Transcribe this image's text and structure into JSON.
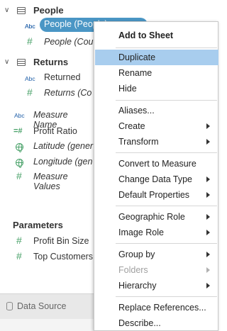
{
  "data_pane": {
    "groups": [
      {
        "name": "People",
        "fields": [
          {
            "label": "People (People)",
            "type": "Abc",
            "selected": true
          },
          {
            "label": "People (Cou",
            "type": "#",
            "italic": true
          }
        ]
      },
      {
        "name": "Returns",
        "fields": [
          {
            "label": "Returned",
            "type": "Abc"
          },
          {
            "label": "Returns (Co",
            "type": "#",
            "italic": true
          }
        ]
      }
    ],
    "loose_fields": [
      {
        "label": "Measure Name",
        "type": "Abc",
        "italic": true
      },
      {
        "label": "Profit Ratio",
        "type": "calc"
      },
      {
        "label": "Latitude (gener",
        "type": "globe",
        "italic": true
      },
      {
        "label": "Longitude (gen",
        "type": "globe",
        "italic": true
      },
      {
        "label": "Measure Values",
        "type": "#",
        "italic": true
      }
    ],
    "parameters": {
      "title": "Parameters",
      "items": [
        {
          "label": "Profit Bin Size",
          "type": "#"
        },
        {
          "label": "Top Customers",
          "type": "#"
        }
      ]
    },
    "data_source_tab": "Data Source",
    "abc_glyph": "Abc",
    "hash_glyph": "#",
    "calc_glyph": "=#"
  },
  "context_menu": {
    "items": [
      {
        "label": "Add to Sheet",
        "bold": true
      },
      {
        "label": "Duplicate",
        "highlighted": true
      },
      {
        "label": "Rename"
      },
      {
        "label": "Hide"
      },
      {
        "label": "Aliases..."
      },
      {
        "label": "Create",
        "submenu": true
      },
      {
        "label": "Transform",
        "submenu": true
      },
      {
        "label": "Convert to Measure"
      },
      {
        "label": "Change Data Type",
        "submenu": true
      },
      {
        "label": "Default Properties",
        "submenu": true
      },
      {
        "label": "Geographic Role",
        "submenu": true
      },
      {
        "label": "Image Role",
        "submenu": true
      },
      {
        "label": "Group by",
        "submenu": true
      },
      {
        "label": "Folders",
        "submenu": true,
        "disabled": true
      },
      {
        "label": "Hierarchy",
        "submenu": true
      },
      {
        "label": "Replace References..."
      },
      {
        "label": "Describe..."
      }
    ]
  },
  "colors": {
    "selection_pill": "#4a96c5",
    "menu_highlight": "#a8cdee",
    "dimension_icon": "#1f5fa8",
    "measure_icon": "#4aa26a"
  }
}
